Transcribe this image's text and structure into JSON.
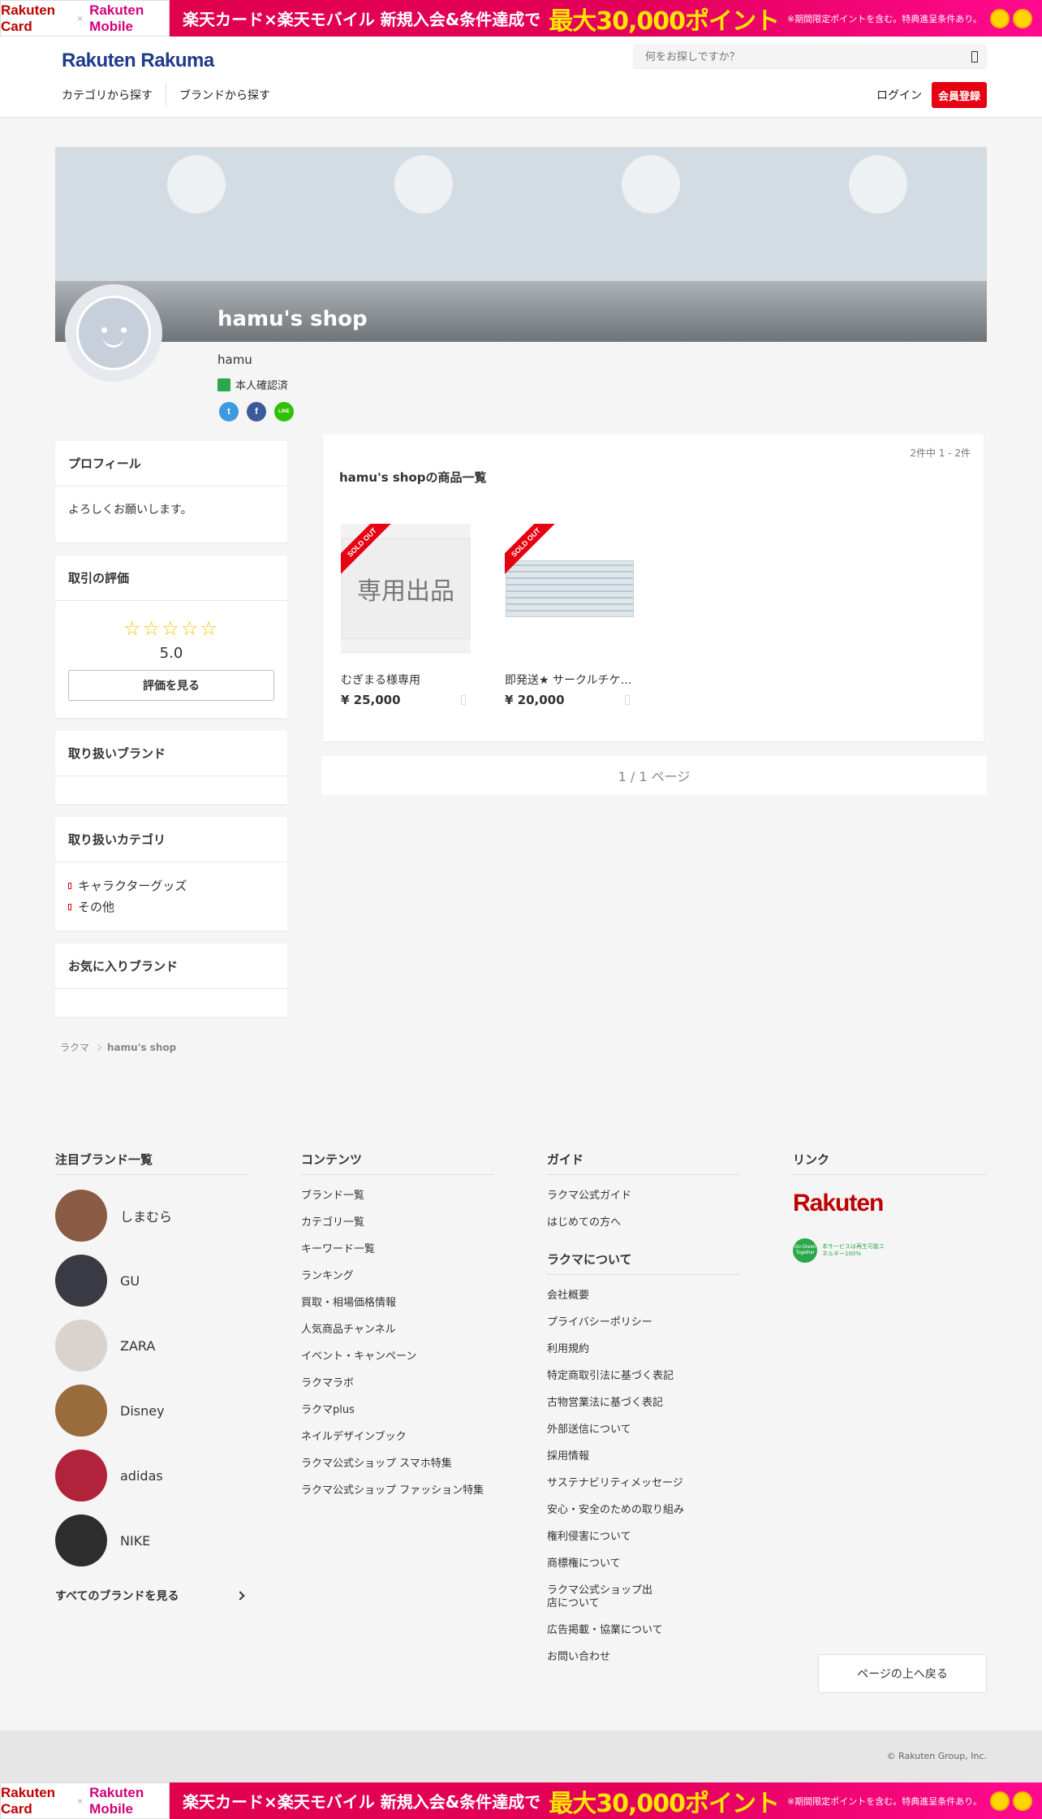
{
  "promo": {
    "card_brand": "Rakuten Card",
    "cross": "×",
    "mobile_brand": "Rakuten Mobile",
    "text": "楽天カード×楽天モバイル 新規入会&条件達成で",
    "big": "最大30,000ポイント",
    "note": "※期間限定ポイントを含む。特典進呈条件あり。"
  },
  "header": {
    "logo": "Rakuten Rakuma",
    "search_placeholder": "何をお探しですか？",
    "nav_category": "カテゴリから探す",
    "nav_brand": "ブランドから探す",
    "login": "ログイン",
    "signup": "会員登録"
  },
  "shop": {
    "title": "hamu's shop",
    "username": "hamu",
    "verified": "本人確認済",
    "social_twitter": "t",
    "social_facebook": "f",
    "social_line": "LINE"
  },
  "sidebar": {
    "profile_title": "プロフィール",
    "profile_text": "よろしくお願いします。",
    "rating_title": "取引の評価",
    "stars": "☆☆☆☆☆",
    "rating_score": "5.0",
    "rating_button": "評価を見る",
    "brands_title": "取り扱いブランド",
    "categories_title": "取り扱いカテゴリ",
    "categories": [
      "キャラクターグッズ",
      "その他"
    ],
    "fav_brands_title": "お気に入りブランド"
  },
  "items": {
    "count": "2件中 1 - 2件",
    "title": "hamu's shopの商品一覧",
    "sold_out": "SOLD OUT",
    "list": [
      {
        "thumb_text": "専用出品",
        "name": "むぎまる様専用",
        "price": "¥ 25,000"
      },
      {
        "name": "即発送★ サークルチケット",
        "price": "¥ 20,000"
      }
    ],
    "pager": "1 / 1 ページ"
  },
  "breadcrumb": {
    "home": "ラクマ",
    "current": "hamu's shop"
  },
  "footer": {
    "brands_title": "注目ブランド一覧",
    "brands": [
      {
        "name": "しまむら",
        "color": "#8a5a44"
      },
      {
        "name": "GU",
        "color": "#3a3a44"
      },
      {
        "name": "ZARA",
        "color": "#d8d3cc"
      },
      {
        "name": "Disney",
        "color": "#9a6b3c"
      },
      {
        "name": "adidas",
        "color": "#b0233a"
      },
      {
        "name": "NIKE",
        "color": "#2d2d2d"
      }
    ],
    "all_brands": "すべてのブランドを見る",
    "contents_title": "コンテンツ",
    "contents": [
      "ブランド一覧",
      "カテゴリ一覧",
      "キーワード一覧",
      "ランキング",
      "買取・相場価格情報",
      "人気商品チャンネル",
      "イベント・キャンペーン",
      "ラクマラボ",
      "ラクマplus",
      "ネイルデザインブック",
      "ラクマ公式ショップ スマホ特集",
      "ラクマ公式ショップ ファッション特集"
    ],
    "guide_title": "ガイド",
    "guide": [
      "ラクマ公式ガイド",
      "はじめての方へ"
    ],
    "about_title": "ラクマについて",
    "about": [
      "会社概要",
      "プライバシーポリシー",
      "利用規約",
      "特定商取引法に基づく表記",
      "古物営業法に基づく表記",
      "外部送信について",
      "採用情報",
      "サステナビリティメッセージ",
      "安心・安全のための取り組み",
      "権利侵害について",
      "商標権について",
      "ラクマ公式ショップ出店について",
      "広告掲載・協業について",
      "お問い合わせ"
    ],
    "links_title": "リンク",
    "rakuten_logo": "Rakuten",
    "green_badge": "Go Green Together",
    "green_text": "本サービスは再生可能エネルギー100%",
    "back_to_top": "ページの上へ戻る",
    "copyright": "© Rakuten Group, Inc."
  },
  "colors": {
    "accent_red": "#e60012",
    "brand_blue": "#1e3c8c",
    "promo_pink": "#e3005a",
    "promo_yellow": "#ffe600"
  }
}
